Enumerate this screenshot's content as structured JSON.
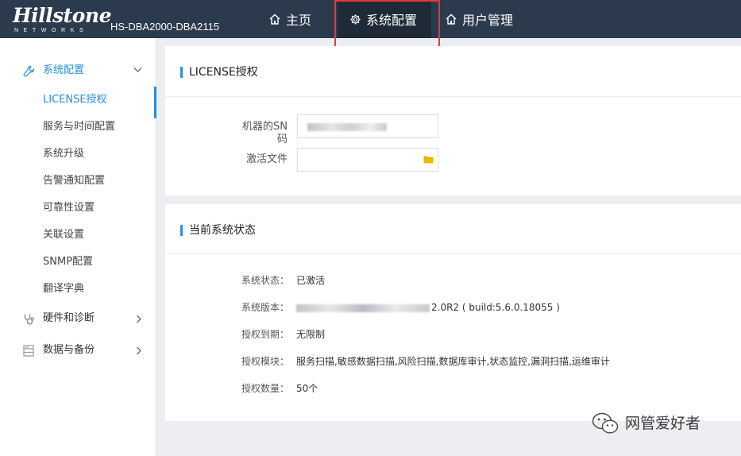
{
  "header": {
    "logo_main": "Hillstone",
    "logo_sub": "NETWORKS",
    "device_model": "HS-DBA2000-DBA2115",
    "nav": [
      {
        "label": "主页",
        "icon": "home-icon"
      },
      {
        "label": "系统配置",
        "icon": "gear-icon"
      },
      {
        "label": "用户管理",
        "icon": "home-icon"
      }
    ]
  },
  "sidebar": {
    "groups": [
      {
        "label": "系统配置",
        "icon": "wrench-icon",
        "expanded": true,
        "items": [
          {
            "label": "LICENSE授权",
            "active": true
          },
          {
            "label": "服务与时间配置"
          },
          {
            "label": "系统升级"
          },
          {
            "label": "告警通知配置"
          },
          {
            "label": "可靠性设置"
          },
          {
            "label": "关联设置"
          },
          {
            "label": "SNMP配置"
          },
          {
            "label": "翻译字典"
          }
        ]
      },
      {
        "label": "硬件和诊断",
        "icon": "stethoscope-icon",
        "expanded": false
      },
      {
        "label": "数据与备份",
        "icon": "database-icon",
        "expanded": false
      }
    ]
  },
  "license_panel": {
    "title": "LICENSE授权",
    "sn_label": "机器的SN码",
    "sn_value": "",
    "activation_label": "激活文件",
    "activation_value": ""
  },
  "status_panel": {
    "title": "当前系统状态",
    "rows": [
      {
        "label": "系统状态：",
        "value": "已激活"
      },
      {
        "label": "系统版本：",
        "value": "2.0R2 ( build:5.6.0.18055 )"
      },
      {
        "label": "授权到期：",
        "value": "无限制"
      },
      {
        "label": "授权模块：",
        "value": "服务扫描,敏感数据扫描,风险扫描,数据库审计,状态监控,漏洞扫描,运维审计"
      },
      {
        "label": "授权数量：",
        "value": "50个"
      }
    ]
  },
  "watermark": {
    "text": "网管爱好者"
  },
  "colors": {
    "header_bg": "#2c3a4d",
    "nav_active_bg": "#1f2a38",
    "accent": "#2a8fd6",
    "highlight": "#e53935",
    "folder": "#f5b400"
  }
}
